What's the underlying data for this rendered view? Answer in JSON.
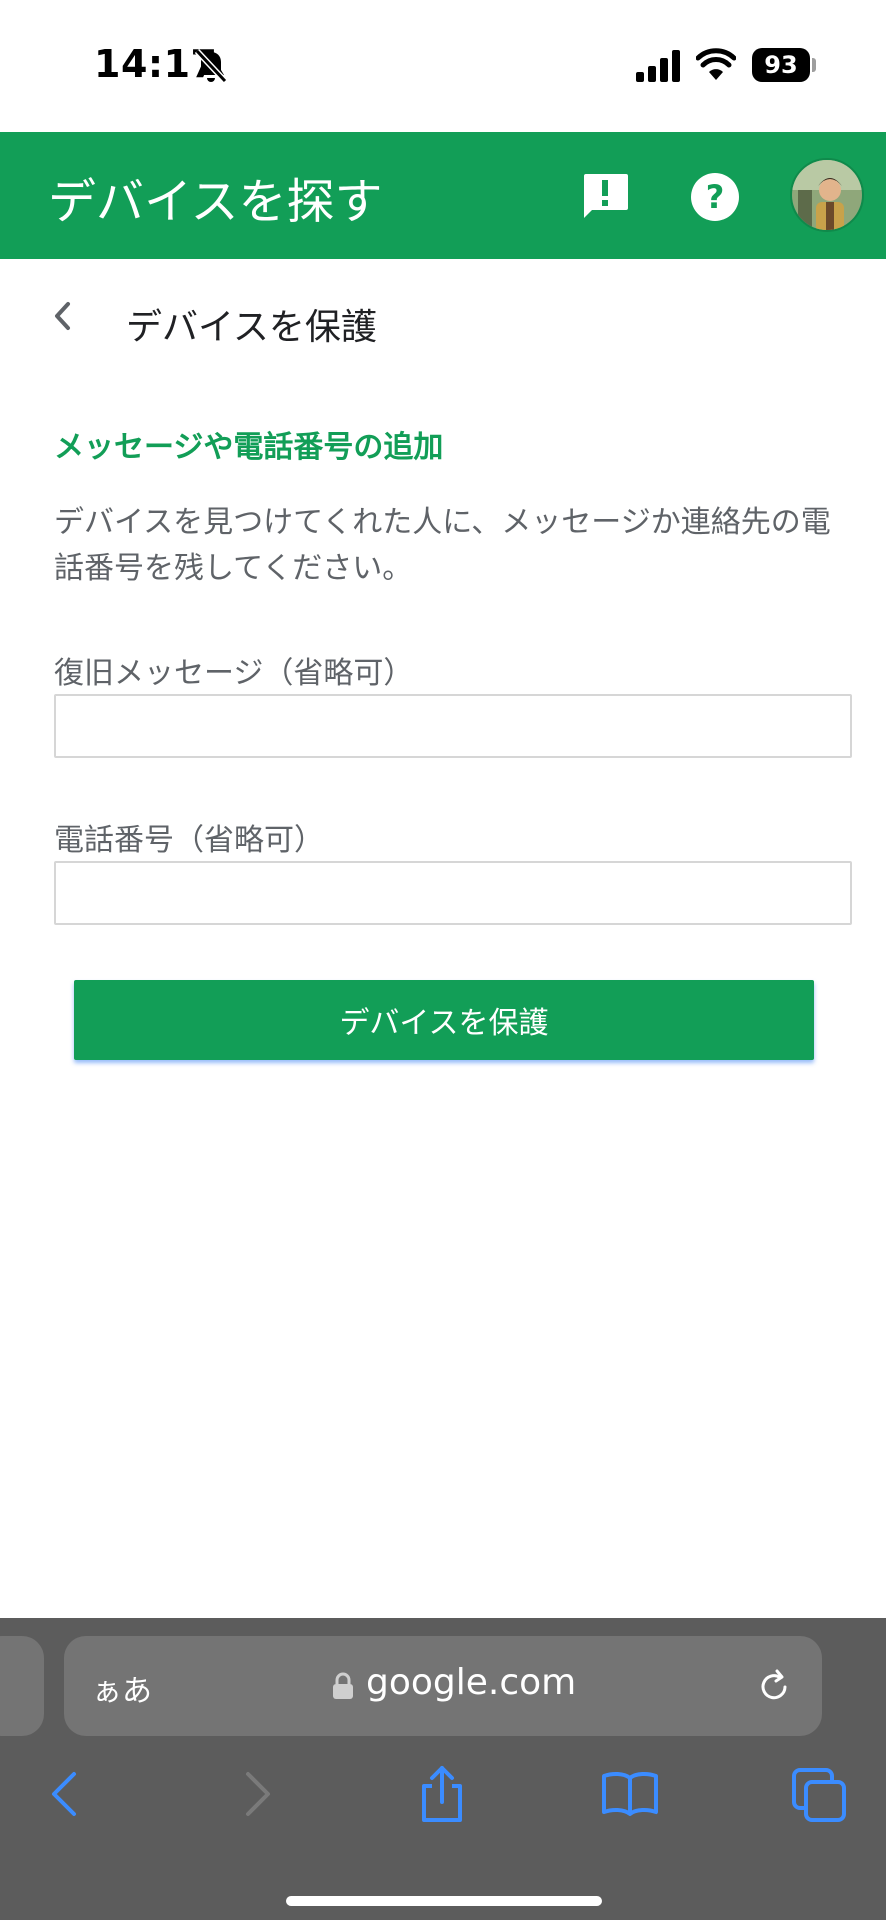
{
  "status_bar": {
    "time": "14:17",
    "battery": "93",
    "icons": [
      "bell-off-icon",
      "signal-icon",
      "wifi-icon",
      "battery-icon"
    ]
  },
  "app_bar": {
    "title": "デバイスを探す",
    "color": "#129e57",
    "icons": [
      "feedback-icon",
      "help-icon",
      "avatar"
    ]
  },
  "page": {
    "title": "デバイスを保護",
    "section_heading": "メッセージや電話番号の追加",
    "description": "デバイスを見つけてくれた人に、メッセージか連絡先の電話番号を残してください。",
    "fields": [
      {
        "label": "復旧メッセージ（省略可）",
        "value": ""
      },
      {
        "label": "電話番号（省略可）",
        "value": ""
      }
    ],
    "submit_label": "デバイスを保護",
    "accent_color": "#129e57"
  },
  "browser": {
    "text_size_label": "ぁあ",
    "url": "google.com",
    "toolbar_icons": [
      "back-icon",
      "forward-icon",
      "share-icon",
      "bookmarks-icon",
      "tabs-icon"
    ]
  }
}
